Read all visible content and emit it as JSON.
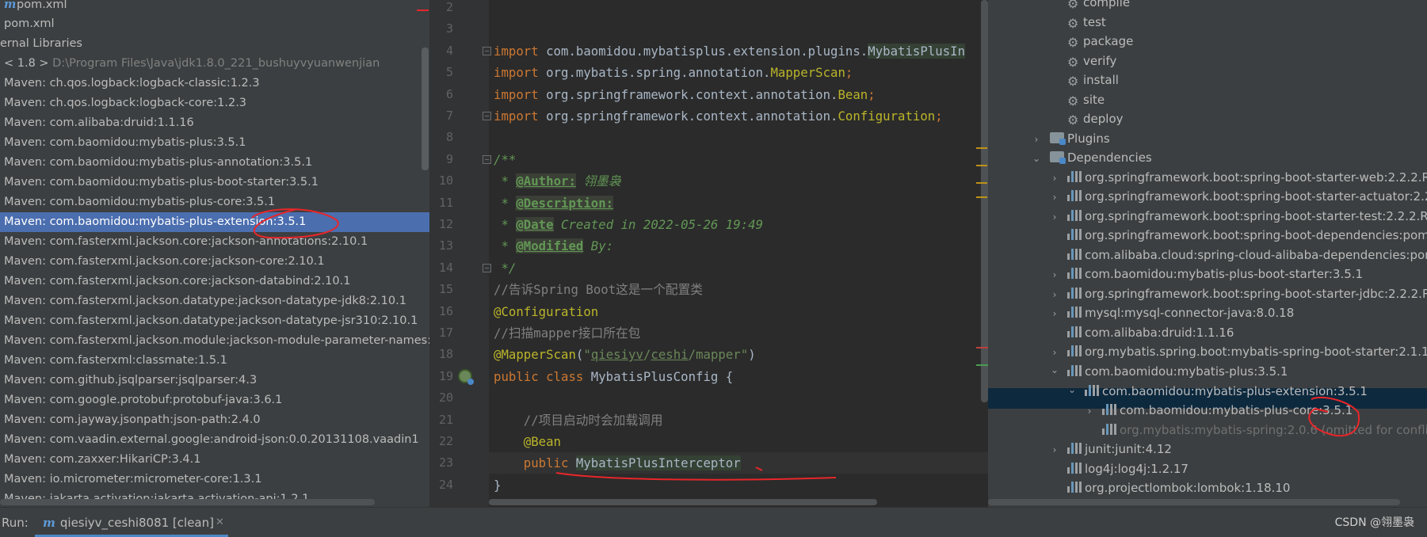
{
  "left_tree": {
    "rows": [
      {
        "text": "pom.xml",
        "icon": "maven-icon",
        "indent": 5
      },
      {
        "text": "pom.xml",
        "icon": "",
        "indent": 5
      },
      {
        "text": "ernal Libraries",
        "icon": "",
        "indent": 0
      },
      {
        "text": "< 1.8 >",
        "dim": "D:\\Program Files\\Java\\jdk1.8.0_221_bushuyvyuanwenjian",
        "icon": "",
        "indent": 5
      },
      {
        "text": "Maven: ch.qos.logback:logback-classic:1.2.3"
      },
      {
        "text": "Maven: ch.qos.logback:logback-core:1.2.3"
      },
      {
        "text": "Maven: com.alibaba:druid:1.1.16"
      },
      {
        "text": "Maven: com.baomidou:mybatis-plus:3.5.1"
      },
      {
        "text": "Maven: com.baomidou:mybatis-plus-annotation:3.5.1"
      },
      {
        "text": "Maven: com.baomidou:mybatis-plus-boot-starter:3.5.1"
      },
      {
        "text": "Maven: com.baomidou:mybatis-plus-core:3.5.1"
      },
      {
        "text": "Maven: com.baomidou:mybatis-plus-extension:3.5.1",
        "selected": true
      },
      {
        "text": "Maven: com.fasterxml.jackson.core:jackson-annotations:2.10.1"
      },
      {
        "text": "Maven: com.fasterxml.jackson.core:jackson-core:2.10.1"
      },
      {
        "text": "Maven: com.fasterxml.jackson.core:jackson-databind:2.10.1"
      },
      {
        "text": "Maven: com.fasterxml.jackson.datatype:jackson-datatype-jdk8:2.10.1"
      },
      {
        "text": "Maven: com.fasterxml.jackson.datatype:jackson-datatype-jsr310:2.10.1"
      },
      {
        "text": "Maven: com.fasterxml.jackson.module:jackson-module-parameter-names:"
      },
      {
        "text": "Maven: com.fasterxml:classmate:1.5.1"
      },
      {
        "text": "Maven: com.github.jsqlparser:jsqlparser:4.3"
      },
      {
        "text": "Maven: com.google.protobuf:protobuf-java:3.6.1"
      },
      {
        "text": "Maven: com.jayway.jsonpath:json-path:2.4.0"
      },
      {
        "text": "Maven: com.vaadin.external.google:android-json:0.0.20131108.vaadin1"
      },
      {
        "text": "Maven: com.zaxxer:HikariCP:3.4.1"
      },
      {
        "text": "Maven: io.micrometer:micrometer-core:1.3.1"
      },
      {
        "text": "Maven: jakarta.activation:jakarta.activation-api:1.2.1"
      }
    ]
  },
  "editor": {
    "lines": [
      {
        "n": "2",
        "html": ""
      },
      {
        "n": "3",
        "html": ""
      },
      {
        "n": "4",
        "html": "<span class='kw'>import</span> com.baomidou.mybatisplus.extension.plugins.<span class='cls-hl'>MybatisPlusIn</span>"
      },
      {
        "n": "5",
        "html": "<span class='kw'>import</span> org.mybatis.spring.annotation.<span class='ann'>MapperScan</span><span class='kw'>;</span>"
      },
      {
        "n": "6",
        "html": "<span class='kw'>import</span> org.springframework.context.annotation.<span class='ann'>Bean</span><span class='kw'>;</span>"
      },
      {
        "n": "7",
        "html": "<span class='kw'>import</span> org.springframework.context.annotation.<span class='ann'>Configuration</span><span class='kw'>;</span>"
      },
      {
        "n": "8",
        "html": ""
      },
      {
        "n": "9",
        "html": "<span class='doc'>/**</span>"
      },
      {
        "n": "10",
        "html": "<span class='doc'> * </span><span class='doctag'>@Author:</span><span class='doc'> 翎墨袅</span>"
      },
      {
        "n": "11",
        "html": "<span class='doc'> * </span><span class='doctag'>@Description:</span>"
      },
      {
        "n": "12",
        "html": "<span class='doc'> * </span><span class='doctag'>@Date</span><span class='doc'> Created in 2022-05-26 19:49</span>"
      },
      {
        "n": "13",
        "html": "<span class='doc'> * </span><span class='doctag'>@Modified</span><span class='doc'> By:</span>"
      },
      {
        "n": "14",
        "html": "<span class='doc'> */</span>"
      },
      {
        "n": "15",
        "html": "<span class='cm'>//告诉Spring Boot这是一个配置类</span>"
      },
      {
        "n": "16",
        "html": "<span class='hl'>@Configuration</span>"
      },
      {
        "n": "17",
        "html": "<span class='cm'>//扫描mapper接口所在包</span>"
      },
      {
        "n": "18",
        "html": "<span class='hl'>@MapperScan</span>(<span class='str'>\"</span><span class='strul'>qiesiyv</span><span class='str'>/</span><span class='strul'>ceshi</span><span class='str'>/mapper\"</span>)"
      },
      {
        "n": "19",
        "html": "<span class='kw'>public class</span> MybatisPlusConfig {"
      },
      {
        "n": "20",
        "html": ""
      },
      {
        "n": "21",
        "html": "    <span class='cm'>//项目启动时会加载调用</span>"
      },
      {
        "n": "22",
        "html": "    <span class='hl'>@Bean</span>"
      },
      {
        "n": "23",
        "html": "    <span class='kw'>public</span> <span class='cls-hl'>MybatisPlusInterceptor</span>"
      },
      {
        "n": "24",
        "html": "}"
      }
    ]
  },
  "maven_panel": {
    "lifecycle": [
      "compile",
      "test",
      "package",
      "verify",
      "install",
      "site",
      "deploy"
    ],
    "plugins_label": "Plugins",
    "dependencies_label": "Dependencies",
    "deps": [
      {
        "text": "org.springframework.boot:spring-boot-starter-web:2.2.2.R",
        "level": 1,
        "arrow": "right"
      },
      {
        "text": "org.springframework.boot:spring-boot-starter-actuator:2.2",
        "level": 1,
        "arrow": "right"
      },
      {
        "text": "org.springframework.boot:spring-boot-starter-test:2.2.2.RE",
        "level": 1,
        "arrow": "right"
      },
      {
        "text": "org.springframework.boot:spring-boot-dependencies:pom",
        "level": 1,
        "arrow": ""
      },
      {
        "text": "com.alibaba.cloud:spring-cloud-alibaba-dependencies:pom",
        "level": 1,
        "arrow": ""
      },
      {
        "text": "com.baomidou:mybatis-plus-boot-starter:3.5.1",
        "level": 1,
        "arrow": "right"
      },
      {
        "text": "org.springframework.boot:spring-boot-starter-jdbc:2.2.2.R",
        "level": 1,
        "arrow": "right"
      },
      {
        "text": "mysql:mysql-connector-java:8.0.18",
        "level": 1,
        "arrow": "right"
      },
      {
        "text": "com.alibaba:druid:1.1.16",
        "level": 1,
        "arrow": ""
      },
      {
        "text": "org.mybatis.spring.boot:mybatis-spring-boot-starter:2.1.1",
        "level": 1,
        "arrow": "right"
      },
      {
        "text": "com.baomidou:mybatis-plus:3.5.1",
        "level": 1,
        "arrow": "down"
      },
      {
        "text": "com.baomidou:mybatis-plus-extension:3.5.1",
        "level": 2,
        "arrow": "down",
        "selected": true
      },
      {
        "text": "com.baomidou:mybatis-plus-core:3.5.1",
        "level": 3,
        "arrow": "right"
      },
      {
        "text": "org.mybatis:mybatis-spring:2.0.6 (omitted for conflict",
        "level": 3,
        "arrow": "",
        "dim": true
      },
      {
        "text": "junit:junit:4.12",
        "level": 1,
        "arrow": "right"
      },
      {
        "text": "log4j:log4j:1.2.17",
        "level": 1,
        "arrow": ""
      },
      {
        "text": "org.projectlombok:lombok:1.18.10",
        "level": 1,
        "arrow": ""
      }
    ]
  },
  "bottom_bar": {
    "run_label": "Run:",
    "run_tab_label": "qiesiyv_ceshi8081 [clean]",
    "close_glyph": "✕",
    "watermark": "CSDN @翎墨袅"
  },
  "colors": {
    "background": "#2b2b2b",
    "panel": "#3c3f41",
    "selection": "#4b6eaf",
    "annotation_red": "#e8262a"
  }
}
